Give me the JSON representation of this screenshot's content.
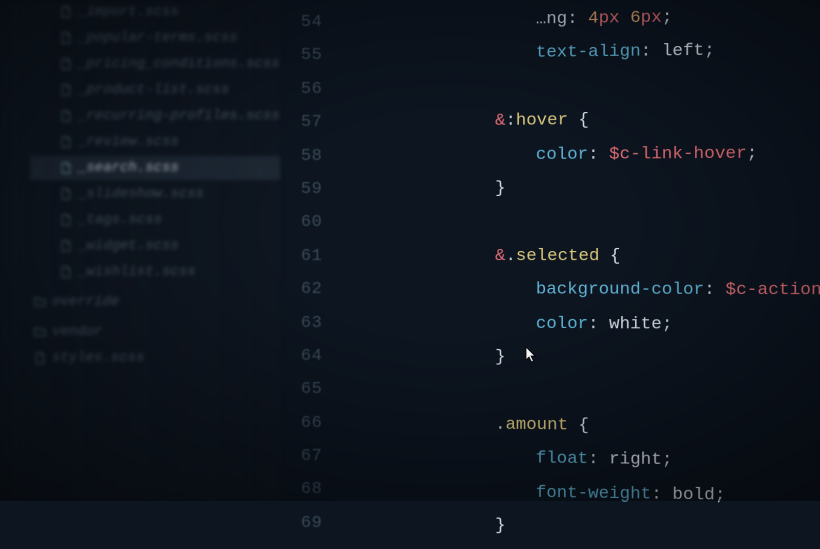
{
  "sidebar": {
    "items": [
      {
        "name": "_import.scss",
        "type": "file",
        "level": 1,
        "selected": false
      },
      {
        "name": "_popular-terms.scss",
        "type": "file",
        "level": 1,
        "selected": false
      },
      {
        "name": "_pricing_conditions.scss",
        "type": "file",
        "level": 1,
        "selected": false
      },
      {
        "name": "_product-list.scss",
        "type": "file",
        "level": 1,
        "selected": false
      },
      {
        "name": "_recurring-profiles.scss",
        "type": "file",
        "level": 1,
        "selected": false
      },
      {
        "name": "_review.scss",
        "type": "file",
        "level": 1,
        "selected": false
      },
      {
        "name": "_search.scss",
        "type": "file",
        "level": 1,
        "selected": true
      },
      {
        "name": "_slideshow.scss",
        "type": "file",
        "level": 1,
        "selected": false
      },
      {
        "name": "_tags.scss",
        "type": "file",
        "level": 1,
        "selected": false
      },
      {
        "name": "_widget.scss",
        "type": "file",
        "level": 1,
        "selected": false
      },
      {
        "name": "_wishlist.scss",
        "type": "file",
        "level": 1,
        "selected": false
      },
      {
        "name": "override",
        "type": "folder",
        "level": 0,
        "selected": false
      },
      {
        "name": "vendor",
        "type": "folder",
        "level": 0,
        "selected": false
      },
      {
        "name": "styles.scss",
        "type": "file",
        "level": 0,
        "selected": false
      }
    ]
  },
  "gutter": {
    "lines": [
      "54",
      "55",
      "56",
      "57",
      "58",
      "59",
      "60",
      "61",
      "62",
      "63",
      "64",
      "65",
      "66",
      "67",
      "68",
      "69"
    ]
  },
  "code": {
    "lines": [
      {
        "indent": 3,
        "tokens": [
          [
            "punct",
            "…ng"
          ],
          [
            "punct",
            ": "
          ],
          [
            "num",
            "4"
          ],
          [
            "unit",
            "px"
          ],
          [
            "punct",
            " "
          ],
          [
            "num",
            "6"
          ],
          [
            "unit",
            "px"
          ],
          [
            "punct",
            ";"
          ]
        ]
      },
      {
        "indent": 3,
        "tokens": [
          [
            "prop",
            "text-align"
          ],
          [
            "punct",
            ": "
          ],
          [
            "val",
            "left"
          ],
          [
            "punct",
            ";"
          ]
        ]
      },
      {
        "indent": 0,
        "tokens": []
      },
      {
        "indent": 2,
        "tokens": [
          [
            "amp",
            "&"
          ],
          [
            "punct",
            ":"
          ],
          [
            "pseudo",
            "hover"
          ],
          [
            "punct",
            " "
          ],
          [
            "brace",
            "{"
          ]
        ]
      },
      {
        "indent": 3,
        "tokens": [
          [
            "prop",
            "color"
          ],
          [
            "punct",
            ": "
          ],
          [
            "var",
            "$c-link-hover"
          ],
          [
            "punct",
            ";"
          ]
        ]
      },
      {
        "indent": 2,
        "tokens": [
          [
            "brace",
            "}"
          ]
        ]
      },
      {
        "indent": 0,
        "tokens": []
      },
      {
        "indent": 2,
        "tokens": [
          [
            "amp",
            "&"
          ],
          [
            "punct",
            "."
          ],
          [
            "class",
            "selected"
          ],
          [
            "punct",
            " "
          ],
          [
            "brace",
            "{"
          ]
        ]
      },
      {
        "indent": 3,
        "tokens": [
          [
            "prop",
            "background-color"
          ],
          [
            "punct",
            ": "
          ],
          [
            "var",
            "$c-action"
          ],
          [
            "punct",
            ";"
          ]
        ]
      },
      {
        "indent": 3,
        "tokens": [
          [
            "prop",
            "color"
          ],
          [
            "punct",
            ": "
          ],
          [
            "val",
            "white"
          ],
          [
            "punct",
            ";"
          ]
        ]
      },
      {
        "indent": 2,
        "tokens": [
          [
            "brace",
            "}"
          ]
        ]
      },
      {
        "indent": 0,
        "tokens": []
      },
      {
        "indent": 2,
        "tokens": [
          [
            "punct",
            "."
          ],
          [
            "class",
            "amount"
          ],
          [
            "punct",
            " "
          ],
          [
            "brace",
            "{"
          ]
        ]
      },
      {
        "indent": 3,
        "tokens": [
          [
            "prop",
            "float"
          ],
          [
            "punct",
            ": "
          ],
          [
            "val",
            "right"
          ],
          [
            "punct",
            ";"
          ]
        ]
      },
      {
        "indent": 3,
        "tokens": [
          [
            "prop",
            "font-weight"
          ],
          [
            "punct",
            ": "
          ],
          [
            "val",
            "bold"
          ],
          [
            "punct",
            ";"
          ]
        ]
      },
      {
        "indent": 2,
        "tokens": [
          [
            "brace",
            "}"
          ]
        ]
      }
    ]
  }
}
